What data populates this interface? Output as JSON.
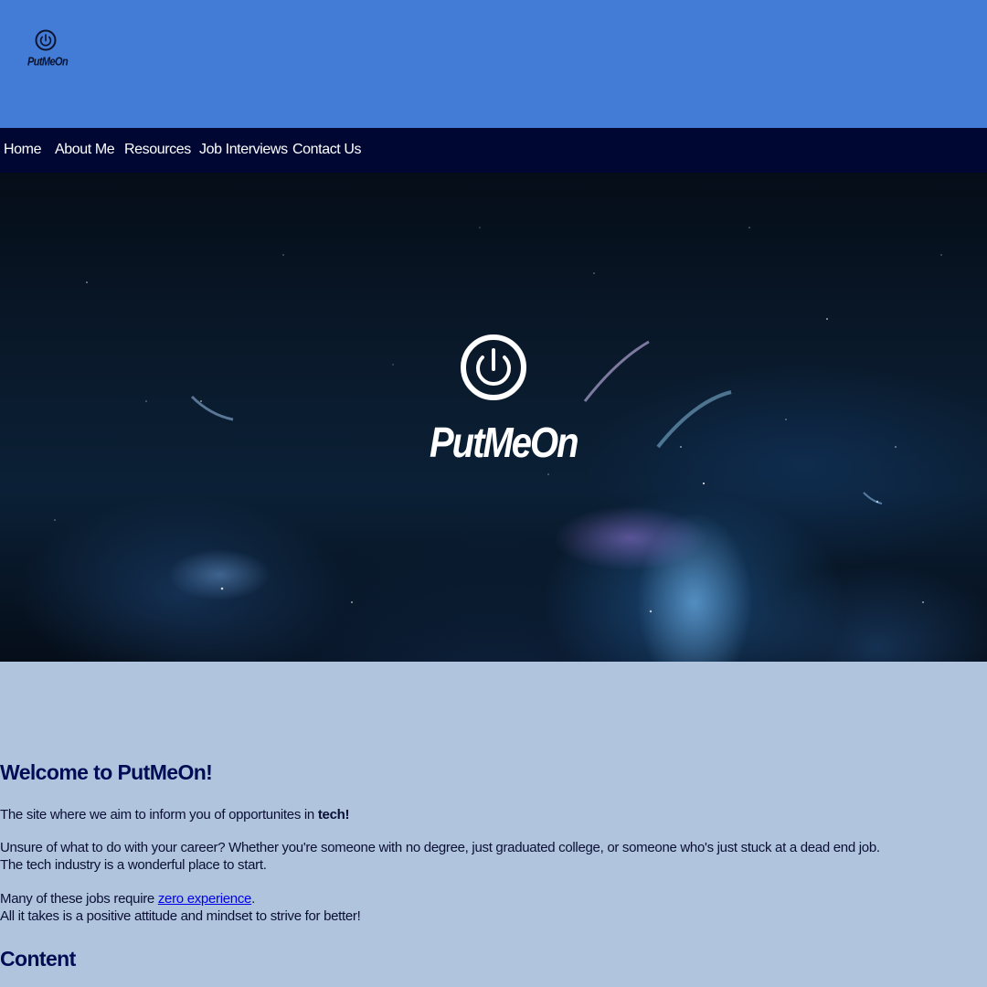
{
  "header": {
    "logo_text": "PutMeOn",
    "background_color": "#427cd6",
    "logo_icon": "power-icon"
  },
  "nav": {
    "background_color": "#000733",
    "items": [
      {
        "label": "Home"
      },
      {
        "label": "About Me"
      },
      {
        "label": "Resources"
      },
      {
        "label": "Job Interviews"
      },
      {
        "label": "Contact Us"
      }
    ]
  },
  "hero": {
    "logo_text": "PutMeOn",
    "logo_icon": "power-icon"
  },
  "main": {
    "welcome_heading": "Welcome to PutMeOn!",
    "intro_text": "The site where we aim to inform you of opportunites in ",
    "intro_bold": "tech!",
    "unsure_line1": "Unsure of what to do with your career? Whether you're someone with no degree, just graduated college, or someone who's just stuck at a dead end job.",
    "unsure_line2": "The tech industry is a wonderful place to start.",
    "jobs_text": "Many of these jobs require ",
    "jobs_link": "zero experience",
    "jobs_period": ".",
    "attitude_line": "All it takes is a positive attitude and mindset to strive for better!",
    "content_heading": "Content"
  }
}
